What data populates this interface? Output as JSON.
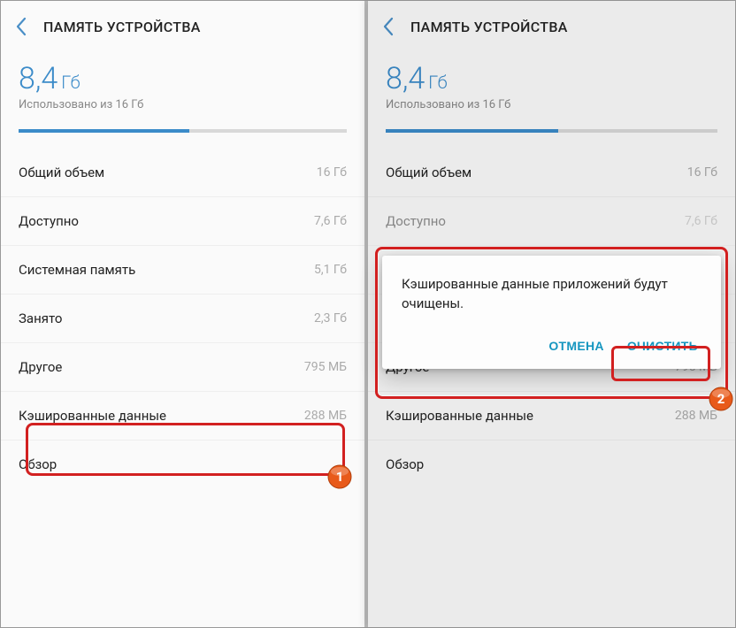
{
  "header": {
    "title": "ПАМЯТЬ УСТРОЙСТВА"
  },
  "storage": {
    "used_value": "8,4",
    "used_unit": "Гб",
    "subtitle": "Использовано из 16 Гб",
    "progress_percent": 52
  },
  "rows": [
    {
      "label": "Общий объем",
      "value": "16 Гб"
    },
    {
      "label": "Доступно",
      "value": "7,6 Гб"
    },
    {
      "label": "Системная память",
      "value": "5,1 Гб"
    },
    {
      "label": "Занято",
      "value": "2,3 Гб"
    },
    {
      "label": "Другое",
      "value": "795 МБ"
    },
    {
      "label": "Кэшированные данные",
      "value": "288 МБ"
    },
    {
      "label": "Обзор",
      "value": ""
    }
  ],
  "dialog": {
    "message": "Кэшированные данные приложений будут очищены.",
    "cancel": "ОТМЕНА",
    "confirm": "ОЧИСТИТЬ"
  },
  "annotations": {
    "badge1": "1",
    "badge2": "2"
  }
}
